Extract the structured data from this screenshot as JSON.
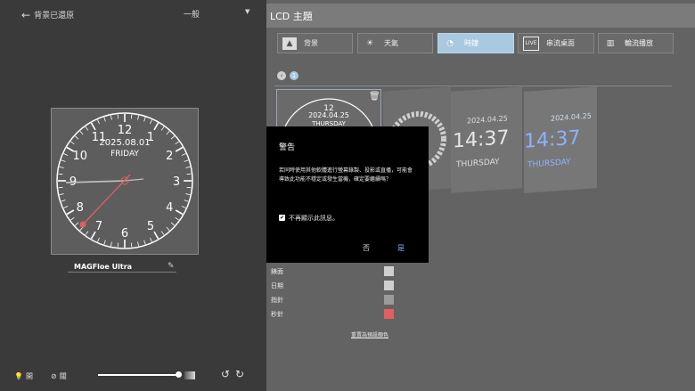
{
  "left_panel": {
    "back_label": "背景已還原",
    "profile_name": "一般",
    "device_name": "MAGFloe Ultra",
    "light_label": "開",
    "off_label": "關"
  },
  "clock_preview": {
    "date": "2025.08.01",
    "day": "FRIDAY",
    "numbers": [
      "12",
      "1",
      "2",
      "3",
      "4",
      "5",
      "6",
      "7",
      "8",
      "9",
      "10",
      "11"
    ]
  },
  "right_panel": {
    "title": "LCD 主題",
    "tabs": [
      {
        "label": "背景",
        "icon": "image-icon"
      },
      {
        "label": "天氣",
        "icon": "weather-icon"
      },
      {
        "label": "時鐘",
        "icon": "clock-icon"
      },
      {
        "label": "串流桌面",
        "icon": "live-icon"
      },
      {
        "label": "輪流播放",
        "icon": "slideshow-icon"
      }
    ],
    "selected_tab": 2,
    "page_number": "1",
    "themes": [
      {
        "date": "2024.04.25",
        "day": "THURSDAY"
      },
      {
        "date": "",
        "day": ""
      },
      {
        "date": "2024.04.25",
        "time": "14:37",
        "day": "THURSDAY"
      },
      {
        "date": "2024.04.25",
        "time": "14:37",
        "day": "THURSDAY"
      }
    ],
    "color_settings": [
      {
        "label": "錶面",
        "color": "#cfcfcf"
      },
      {
        "label": "日期",
        "color": "#cfcfcf"
      },
      {
        "label": "指針",
        "color": "#9b9b9b"
      },
      {
        "label": "秒針",
        "color": "#e06060"
      }
    ],
    "reset_label": "重置為預設顏色"
  },
  "dialog": {
    "title": "警告",
    "message": "若同時使用其他軟體進行螢幕錄製、投影或直播，可能會導致此功能不穩定或發生當機，確定要繼續嗎？",
    "checkbox_label": "不再顯示此訊息。",
    "checkbox_checked": true,
    "no_label": "否",
    "yes_label": "是"
  },
  "colors": {
    "accent": "#7fb3ff",
    "second_hand": "#e06060",
    "active_tab": "#a8c9e0"
  }
}
